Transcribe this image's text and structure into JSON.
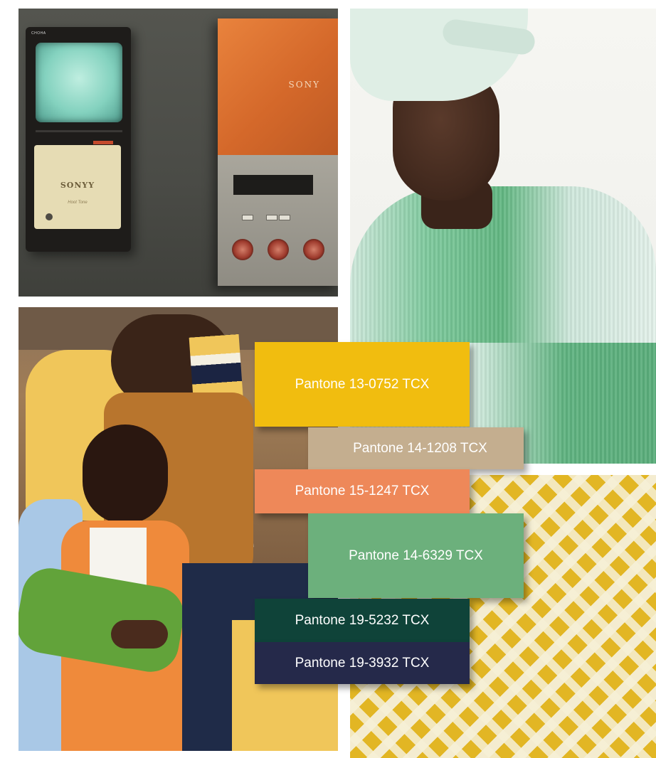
{
  "photos": {
    "sony_devices": {
      "left_device_tiny_label": "CHOHA",
      "left_device_brand": "SONYY",
      "left_device_script": "Hoot Tone",
      "right_device_brand": "SONY"
    },
    "sweater_model": {},
    "group_friends": {},
    "houndstooth": {}
  },
  "swatches": [
    {
      "label": "Pantone 13-0752 TCX",
      "color": "#f1bd0f"
    },
    {
      "label": "Pantone 14-1208 TCX",
      "color": "#c4ae8f"
    },
    {
      "label": "Pantone 15-1247 TCX",
      "color": "#ee8859"
    },
    {
      "label": "Pantone 14-6329 TCX",
      "color": "#6cb07c"
    },
    {
      "label": "Pantone 19-5232 TCX",
      "color": "#0f4339"
    },
    {
      "label": "Pantone 19-3932 TCX",
      "color": "#25294a"
    }
  ]
}
